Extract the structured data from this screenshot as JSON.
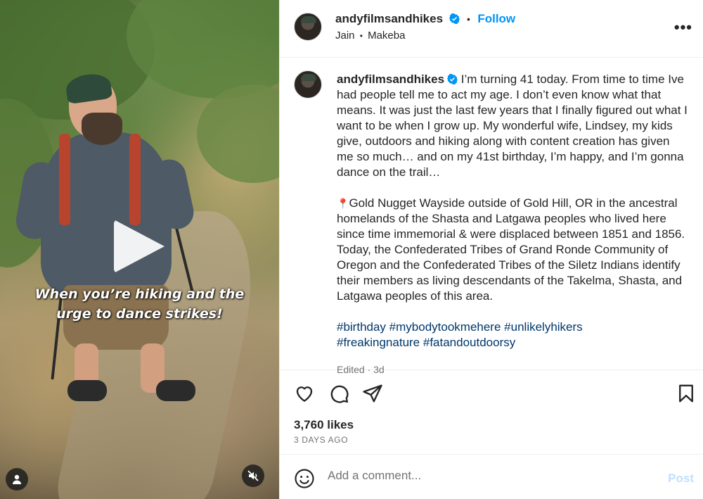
{
  "video": {
    "caption_line1": "When you’re hiking and the",
    "caption_line2": "urge to dance strikes!",
    "play_icon": "play-icon",
    "mute_icon": "muted-speaker-icon",
    "user_icon": "user-tag-icon"
  },
  "header": {
    "username": "andyfilmsandhikes",
    "dot": "•",
    "follow_label": "Follow",
    "audio_artist": "Jain",
    "audio_sep": "•",
    "audio_track": "Makeba",
    "more_icon": "more-options-icon",
    "more_label": "•••"
  },
  "post": {
    "username": "andyfilmsandhikes",
    "caption_p1": "I’m turning 41 today. From time to time Ive had people tell me to act my age. I don’t even know what that means. It was just the last few years that I finally figured out what I want to be when I grow up. My wonderful wife, Lindsey, my kids give, outdoors and hiking along with content creation has given me so much… and on my 41st birthday, I’m happy, and I’m gonna dance on the trail…",
    "location_pin": "📍",
    "caption_p2": "Gold Nugget Wayside outside of Gold Hill, OR in the ancestral homelands of the Shasta and Latgawa peoples who lived here since time immemorial & were displaced between 1851 and 1856. Today, the Confederated Tribes of Grand Ronde Community of Oregon and the Confederated Tribes of the Siletz Indians identify their members as living descendants of the Takelma, Shasta, and Latgawa peoples of this area.",
    "hashtags": [
      "#birthday",
      "#mybodytookmehere",
      "#unlikelyhikers",
      "#freakingnature",
      "#fatandoutdoorsy"
    ],
    "edited_meta": "Edited · 3d"
  },
  "actions": {
    "like_icon": "heart-icon",
    "comment_icon": "comment-icon",
    "share_icon": "share-icon",
    "save_icon": "bookmark-icon",
    "likes": "3,760 likes",
    "date": "3 DAYS AGO"
  },
  "comment": {
    "emoji_icon": "emoji-icon",
    "placeholder": "Add a comment...",
    "post_label": "Post"
  },
  "colors": {
    "accent": "#0095f6",
    "hashtag": "#00376b",
    "muted": "#737373",
    "post_disabled": "#c0dffd"
  }
}
